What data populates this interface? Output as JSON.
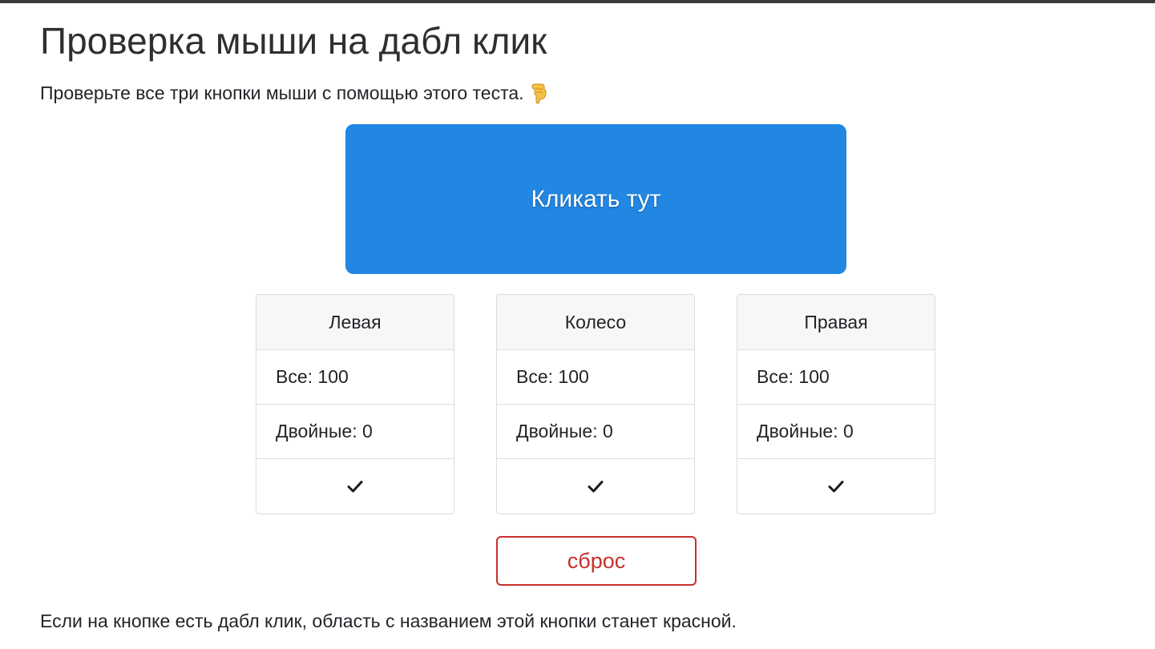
{
  "page": {
    "title": "Проверка мыши на дабл клик",
    "intro": "Проверьте все три кнопки мыши с помощью этого теста.",
    "intro_icon": "pointing-down-hand-icon",
    "footer_note": "Если на кнопке есть дабл клик, область с названием этой кнопки станет красной."
  },
  "click_area": {
    "label": "Кликать тут",
    "color": "#2187e3"
  },
  "buttons": [
    {
      "name": "Левая",
      "all_label": "Все: 100",
      "double_label": "Двойные: 0",
      "status_icon": "check-icon"
    },
    {
      "name": "Колесо",
      "all_label": "Все: 100",
      "double_label": "Двойные: 0",
      "status_icon": "check-icon"
    },
    {
      "name": "Правая",
      "all_label": "Все: 100",
      "double_label": "Двойные: 0",
      "status_icon": "check-icon"
    }
  ],
  "reset": {
    "label": "сброс",
    "color": "#c9302c"
  }
}
